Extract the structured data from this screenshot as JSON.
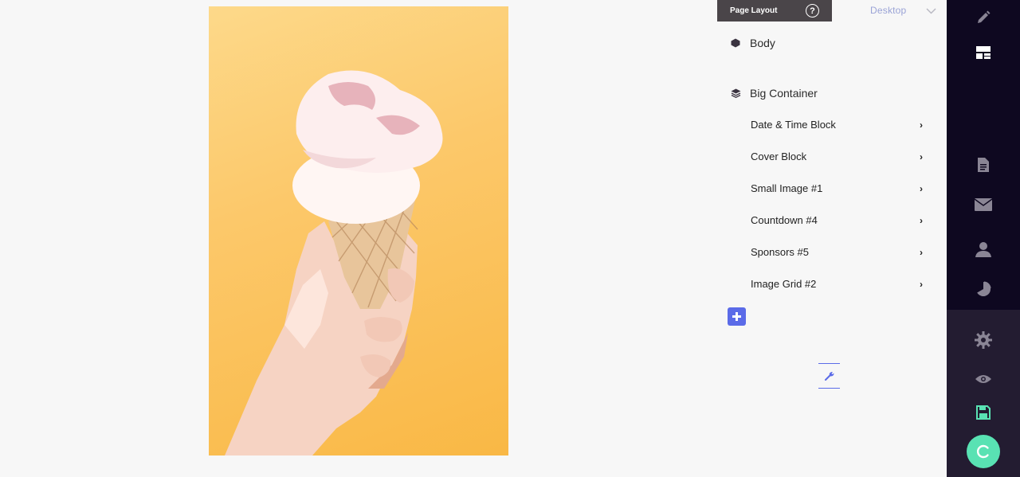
{
  "panel": {
    "tab_title": "Page Layout",
    "help_glyph": "?",
    "device_label": "Desktop",
    "device_icon": "chevron-down-icon",
    "body_label": "Body",
    "container_label": "Big Container",
    "blocks": [
      {
        "label": "Date & Time Block"
      },
      {
        "label": "Cover Block"
      },
      {
        "label": "Small Image #1"
      },
      {
        "label": "Countdown #4"
      },
      {
        "label": "Sponsors #5"
      },
      {
        "label": "Image Grid #2"
      }
    ],
    "accent_color": "#5b6be8"
  },
  "preview": {
    "image": "ice-cream-cone-in-hand"
  },
  "sidebar": {
    "icons": [
      "pencil-icon",
      "layout-icon",
      "document-icon",
      "mail-icon",
      "user-icon",
      "pie-chart-icon",
      "gear-icon",
      "eye-icon",
      "save-icon"
    ],
    "launch_color": "#59e2b3"
  }
}
